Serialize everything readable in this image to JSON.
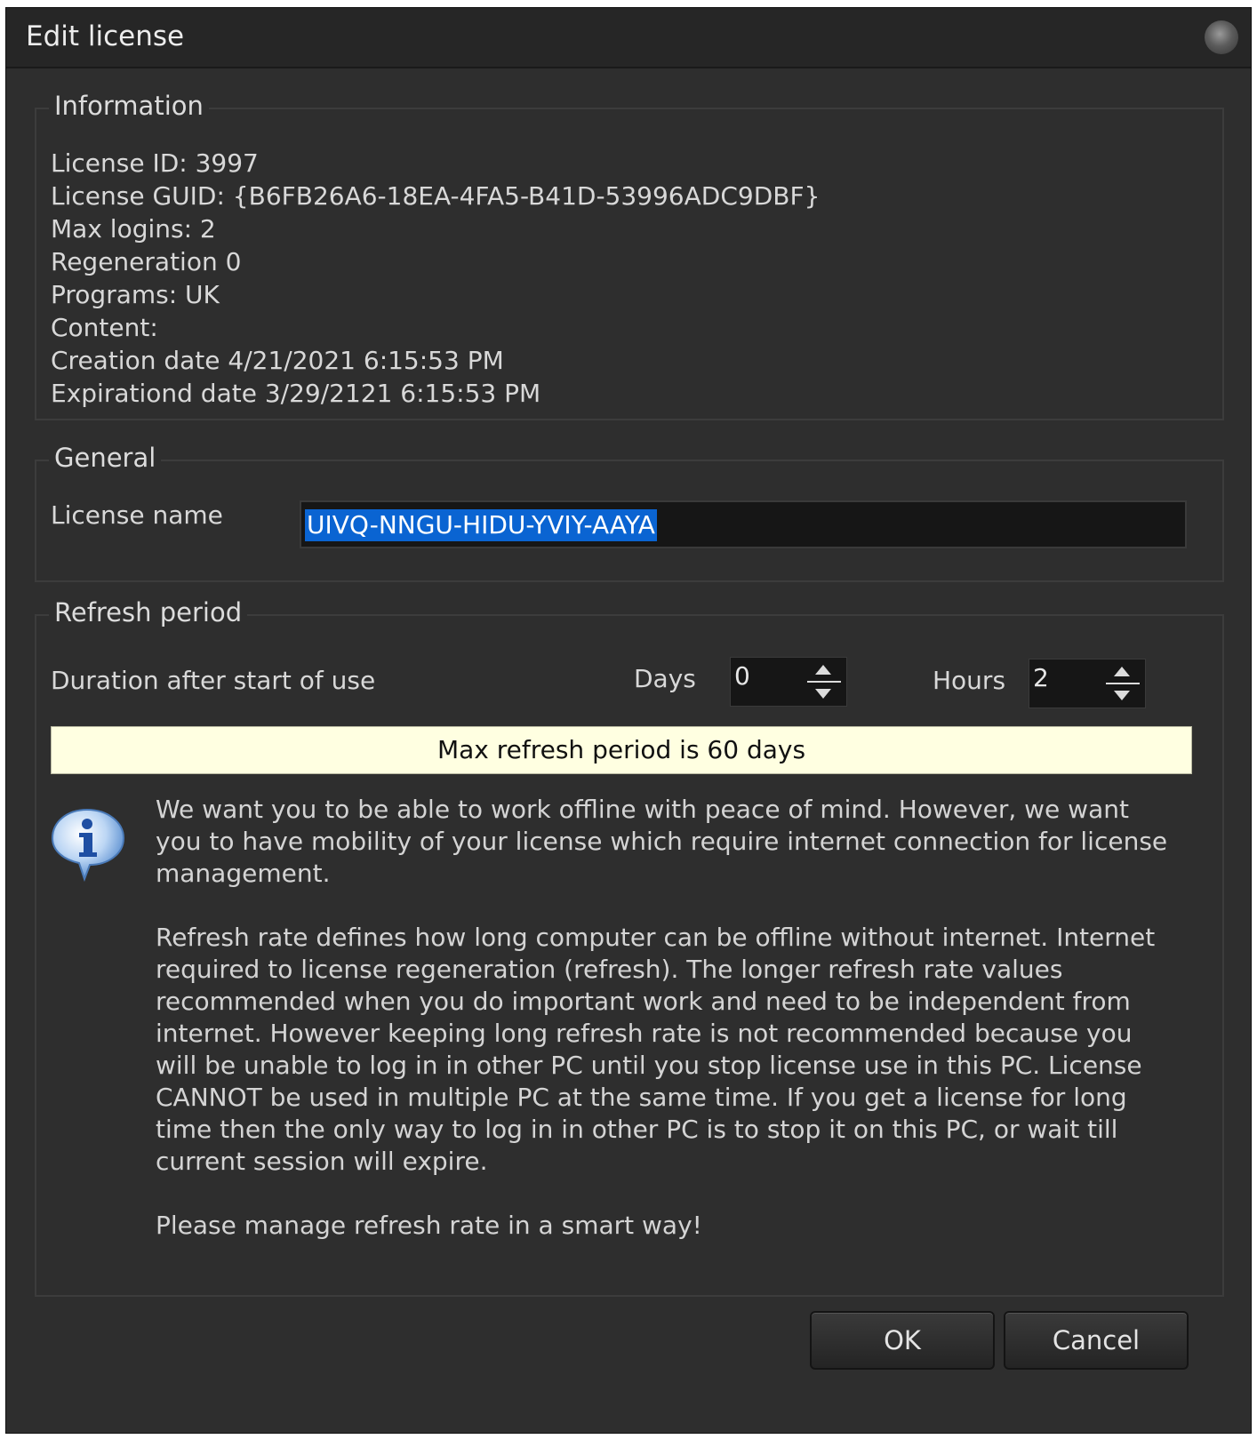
{
  "window": {
    "title": "Edit license"
  },
  "information": {
    "legend": "Information",
    "lines": [
      "License ID: 3997",
      "License GUID: {B6FB26A6-18EA-4FA5-B41D-53996ADC9DBF}",
      "Max logins: 2",
      "Regeneration 0",
      "Programs: UK",
      "Content:",
      "Creation date 4/21/2021 6:15:53 PM",
      "Expirationd date 3/29/2121 6:15:53 PM"
    ]
  },
  "general": {
    "legend": "General",
    "license_name_label": "License name",
    "license_name_value": "UIVQ-NNGU-HIDU-YVIY-AAYA"
  },
  "refresh": {
    "legend": "Refresh period",
    "duration_label": "Duration after start of use",
    "days_label": "Days",
    "days_value": "0",
    "hours_label": "Hours",
    "hours_value": "2",
    "banner": "Max refresh period is 60 days",
    "icon": "info-icon",
    "paragraphs": [
      "We want you to be able to work offline with peace of mind. However, we want you to have mobility of your license which require internet connection for license management.",
      "Refresh rate defines how long computer can be offline without internet. Internet required to license regeneration (refresh). The longer refresh rate values recommended when you do important work and need to be independent from internet. However keeping long refresh rate is not recommended because you will be unable to log in in other PC until you stop license use in this PC. License CANNOT be used in multiple PC at the same time. If you get a license for long time then the only way to log in in other PC is to stop it on this PC, or wait till current session will expire.",
      "Please manage refresh rate in a smart way!"
    ]
  },
  "buttons": {
    "ok": "OK",
    "cancel": "Cancel"
  }
}
